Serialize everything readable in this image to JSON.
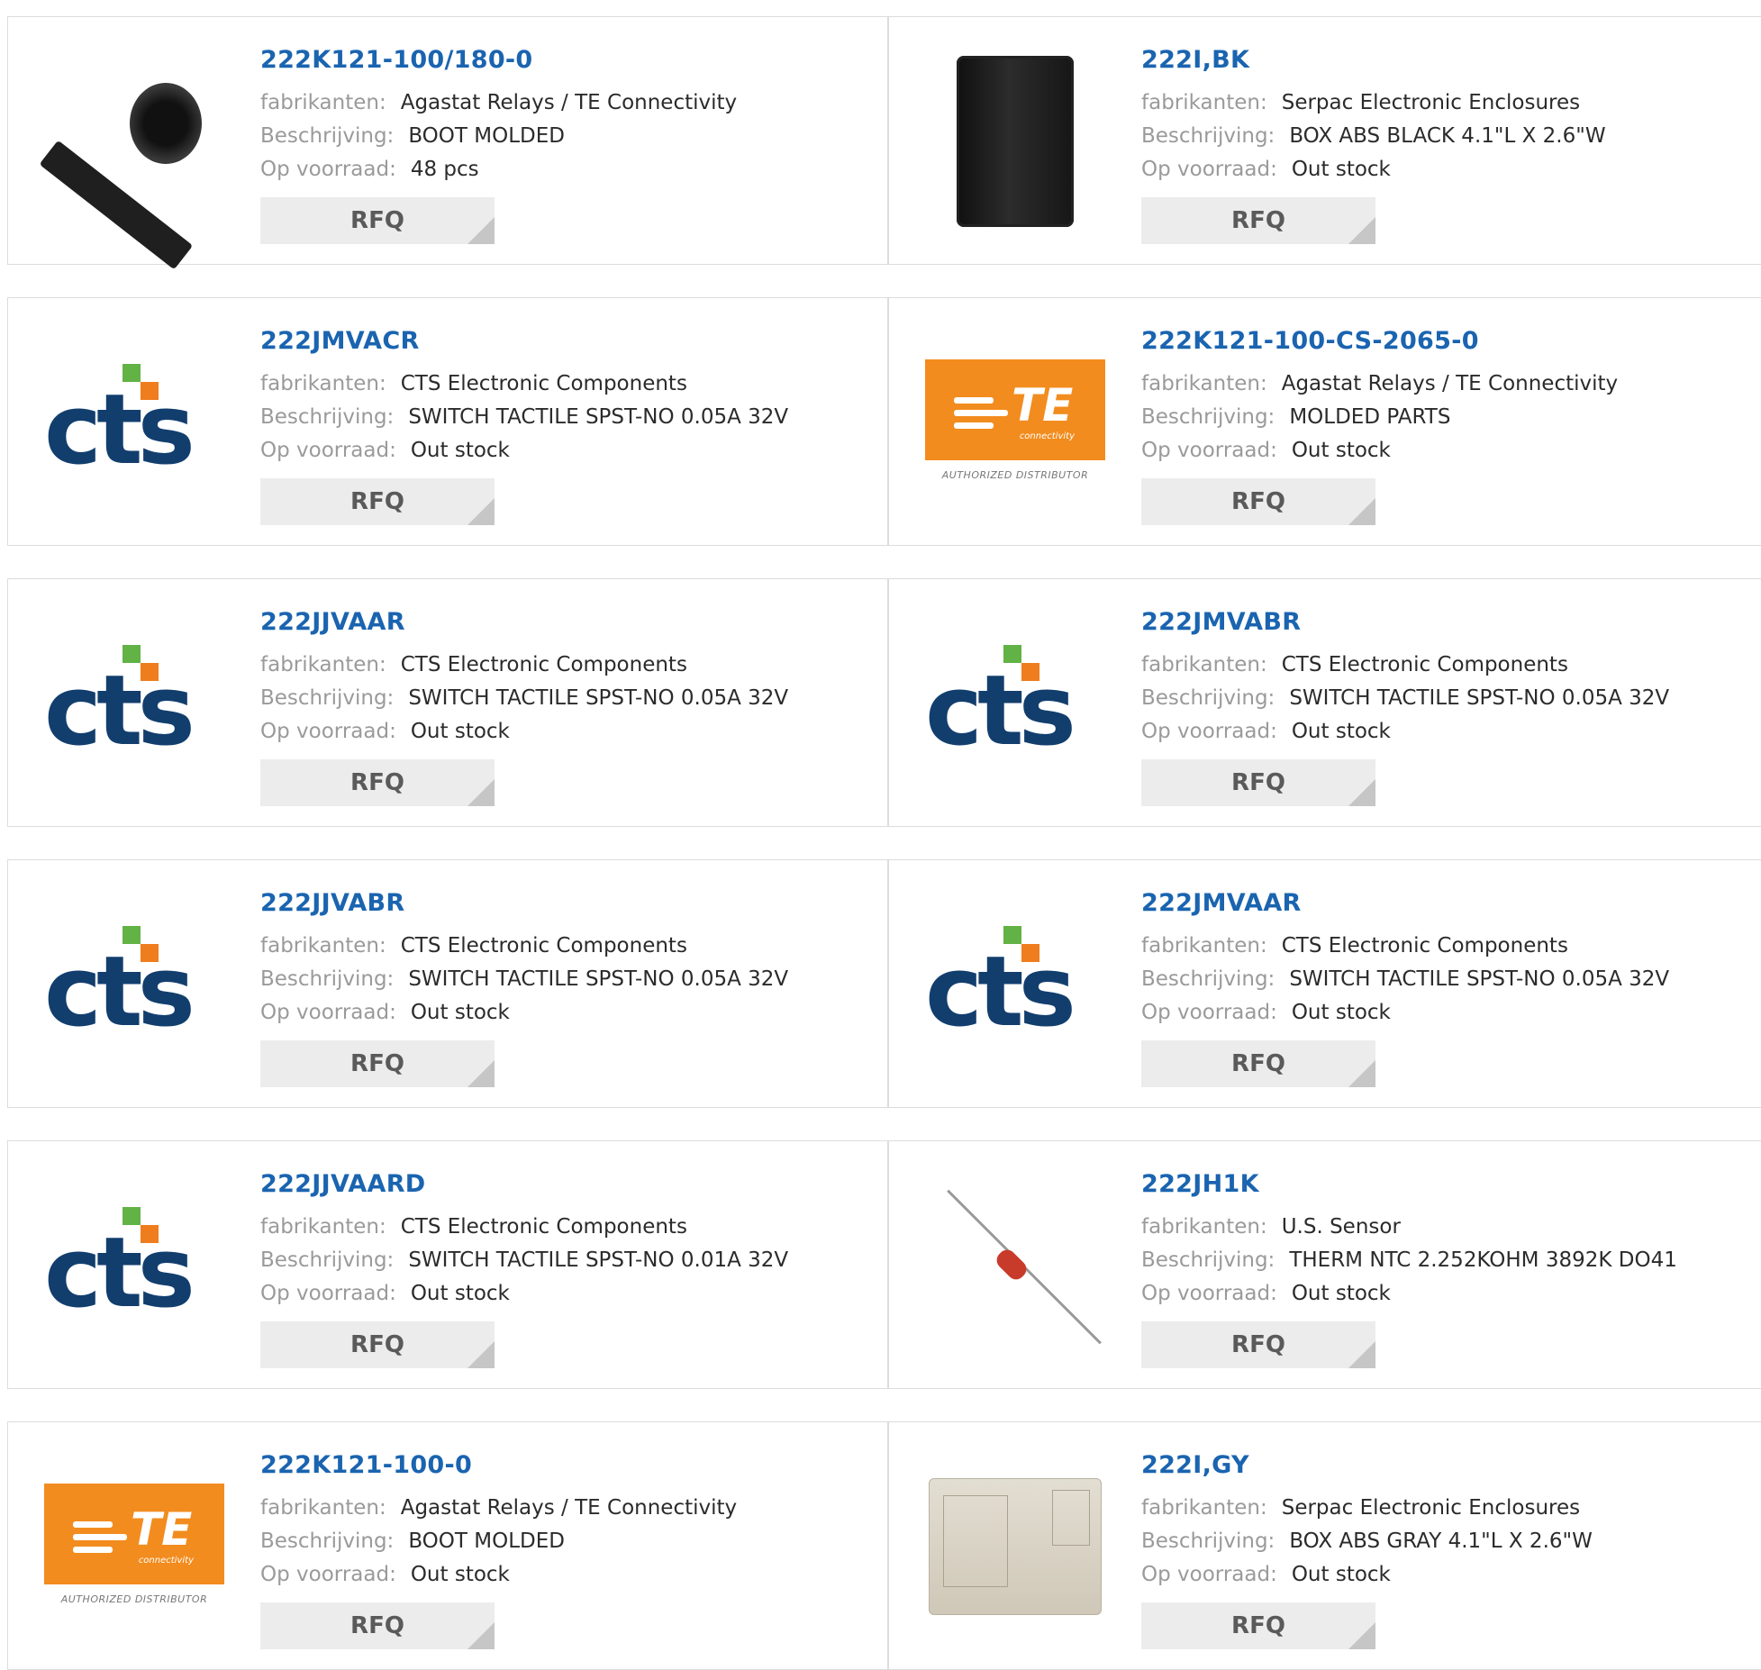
{
  "labels": {
    "manufacturer": "fabrikanten:",
    "description": "Beschrijving:",
    "stock": "Op voorraad:",
    "rfq": "RFQ"
  },
  "products": [
    {
      "part": "222K121-100/180-0",
      "manufacturer": "Agastat Relays / TE Connectivity",
      "description": "BOOT MOLDED",
      "stock": "48 pcs",
      "image": "boot-photo"
    },
    {
      "part": "222I,BK",
      "manufacturer": "Serpac Electronic Enclosures",
      "description": "BOX ABS BLACK 4.1\"L X 2.6\"W",
      "stock": "Out stock",
      "image": "black-box-photo"
    },
    {
      "part": "222JMVACR",
      "manufacturer": "CTS Electronic Components",
      "description": "SWITCH TACTILE SPST-NO 0.05A 32V",
      "stock": "Out stock",
      "image": "cts-logo"
    },
    {
      "part": "222K121-100-CS-2065-0",
      "manufacturer": "Agastat Relays / TE Connectivity",
      "description": "MOLDED PARTS",
      "stock": "Out stock",
      "image": "te-logo"
    },
    {
      "part": "222JJVAAR",
      "manufacturer": "CTS Electronic Components",
      "description": "SWITCH TACTILE SPST-NO 0.05A 32V",
      "stock": "Out stock",
      "image": "cts-logo"
    },
    {
      "part": "222JMVABR",
      "manufacturer": "CTS Electronic Components",
      "description": "SWITCH TACTILE SPST-NO 0.05A 32V",
      "stock": "Out stock",
      "image": "cts-logo"
    },
    {
      "part": "222JJVABR",
      "manufacturer": "CTS Electronic Components",
      "description": "SWITCH TACTILE SPST-NO 0.05A 32V",
      "stock": "Out stock",
      "image": "cts-logo"
    },
    {
      "part": "222JMVAAR",
      "manufacturer": "CTS Electronic Components",
      "description": "SWITCH TACTILE SPST-NO 0.05A 32V",
      "stock": "Out stock",
      "image": "cts-logo"
    },
    {
      "part": "222JJVAARD",
      "manufacturer": "CTS Electronic Components",
      "description": "SWITCH TACTILE SPST-NO 0.01A 32V",
      "stock": "Out stock",
      "image": "cts-logo"
    },
    {
      "part": "222JH1K",
      "manufacturer": "U.S. Sensor",
      "description": "THERM NTC 2.252KOHM 3892K DO41",
      "stock": "Out stock",
      "image": "thermistor-photo"
    },
    {
      "part": "222K121-100-0",
      "manufacturer": "Agastat Relays / TE Connectivity",
      "description": "BOOT MOLDED",
      "stock": "Out stock",
      "image": "te-logo"
    },
    {
      "part": "222I,GY",
      "manufacturer": "Serpac Electronic Enclosures",
      "description": "BOX ABS GRAY 4.1\"L X 2.6\"W",
      "stock": "Out stock",
      "image": "gray-box-photo"
    }
  ],
  "logos": {
    "cts_text": "cts",
    "te_text": "TE",
    "te_sub": "connectivity",
    "te_tag": "AUTHORIZED DISTRIBUTOR"
  },
  "colors": {
    "part_link": "#1a64b0",
    "label": "#9a9a9a",
    "value": "#2b2b2b",
    "rfq_bg": "#ececec",
    "cts_blue": "#123e6e",
    "cts_green": "#62b245",
    "cts_orange": "#ef7d1d",
    "te_orange": "#f28c1e"
  }
}
